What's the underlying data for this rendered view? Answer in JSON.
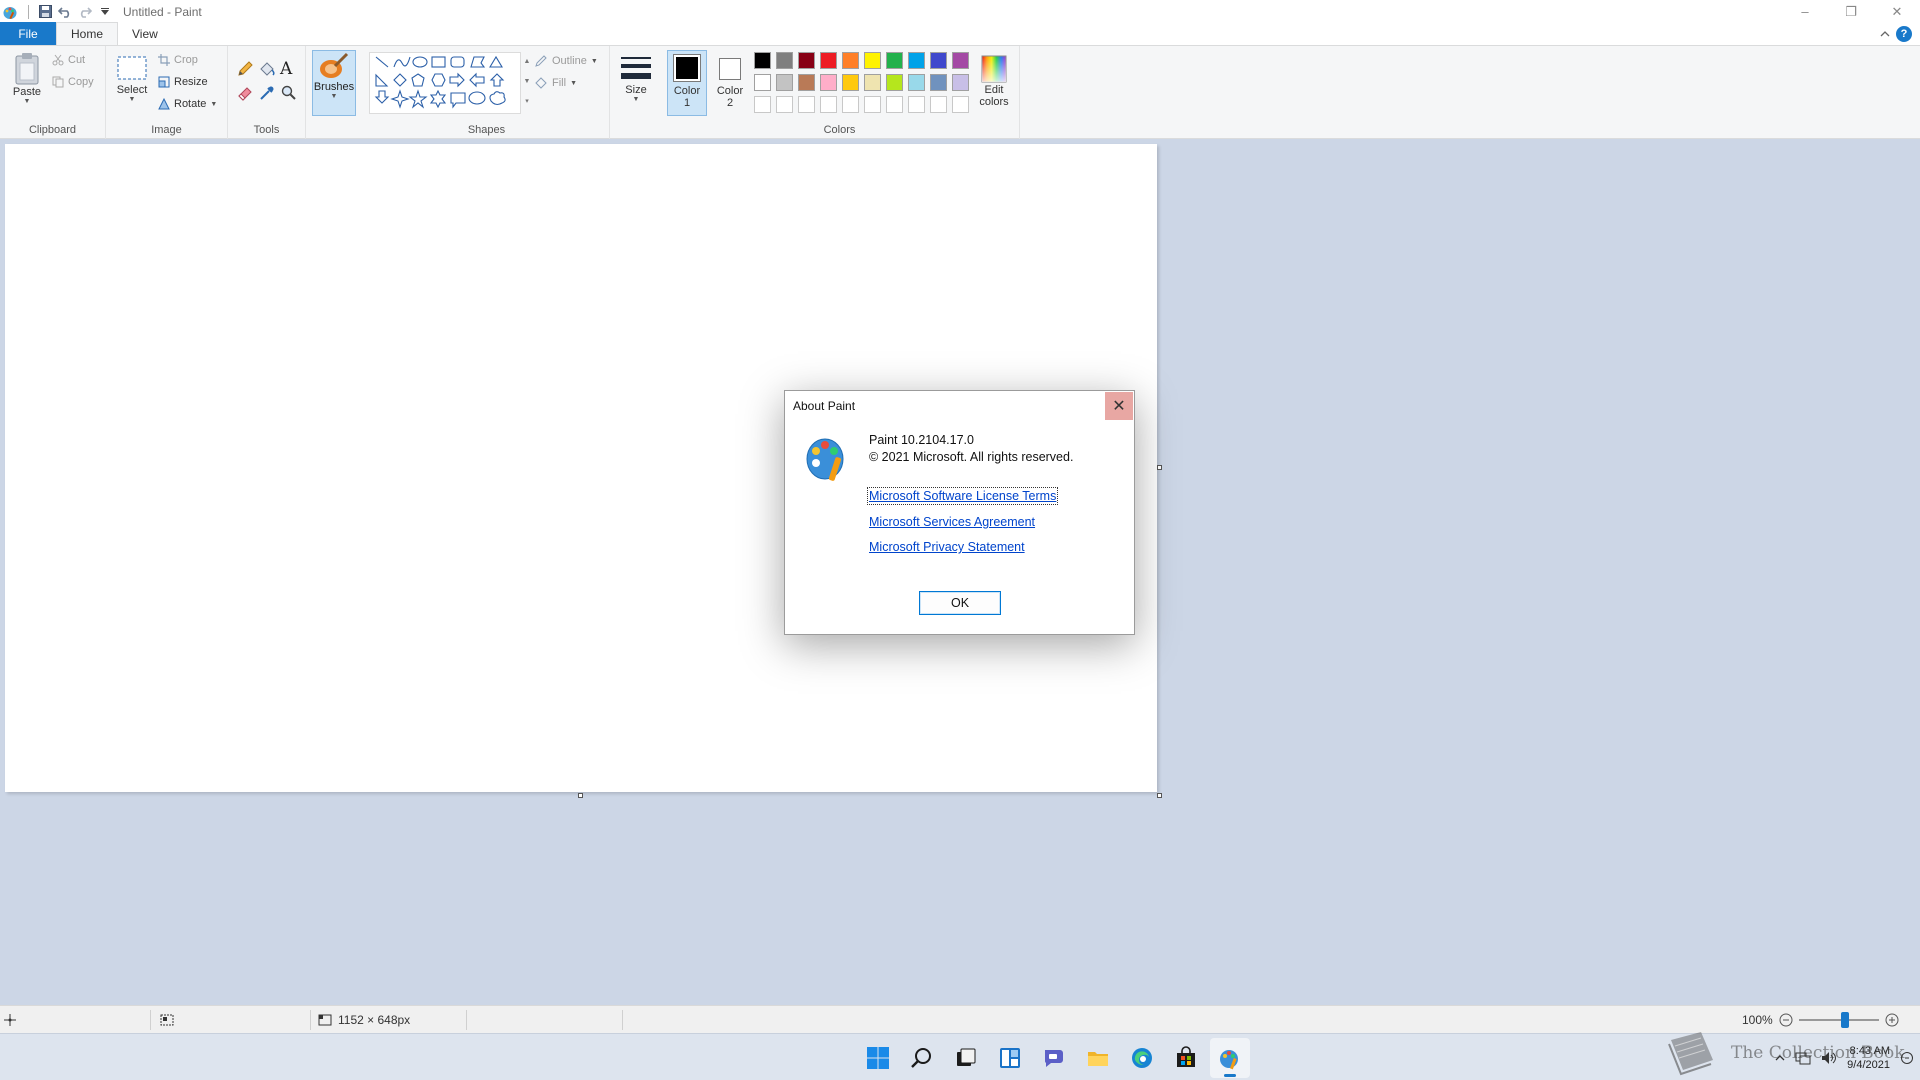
{
  "titlebar": {
    "title": "Untitled - Paint",
    "minimize": "–",
    "restore": "❐",
    "close": "✕"
  },
  "tabs": {
    "file": "File",
    "home": "Home",
    "view": "View"
  },
  "ribbon": {
    "clipboard": {
      "label": "Clipboard",
      "paste": "Paste",
      "cut": "Cut",
      "copy": "Copy"
    },
    "image": {
      "label": "Image",
      "select": "Select",
      "crop": "Crop",
      "resize": "Resize",
      "rotate": "Rotate"
    },
    "tools": {
      "label": "Tools"
    },
    "brushes": {
      "label": "Brushes"
    },
    "shapes": {
      "label": "Shapes",
      "outline": "Outline",
      "fill": "Fill"
    },
    "size": {
      "label": "Size"
    },
    "color1": {
      "line1": "Color",
      "line2": "1",
      "value": "#000000"
    },
    "color2": {
      "line1": "Color",
      "line2": "2",
      "value": "#ffffff"
    },
    "colors": {
      "label": "Colors",
      "edit_line1": "Edit",
      "edit_line2": "colors",
      "row1": [
        "#000000",
        "#7f7f7f",
        "#880015",
        "#ed1c24",
        "#ff7f27",
        "#fff200",
        "#22b14c",
        "#00a2e8",
        "#3f48cc",
        "#a349a4"
      ],
      "row2": [
        "#ffffff",
        "#c3c3c3",
        "#b97a57",
        "#ffaec9",
        "#ffc90e",
        "#efe4b0",
        "#b5e61d",
        "#99d9ea",
        "#7092be",
        "#c8bfe7"
      ],
      "row3": [
        "#ffffff",
        "#ffffff",
        "#ffffff",
        "#ffffff",
        "#ffffff",
        "#ffffff",
        "#ffffff",
        "#ffffff",
        "#ffffff",
        "#ffffff"
      ]
    }
  },
  "statusbar": {
    "dimensions": "1152 × 648px",
    "zoom": "100%"
  },
  "dialog": {
    "title": "About Paint",
    "version": "Paint 10.2104.17.0",
    "copyright": "© 2021 Microsoft. All rights reserved.",
    "link_license": "Microsoft Software License Terms",
    "link_services": "Microsoft Services Agreement",
    "link_privacy": "Microsoft Privacy Statement",
    "ok": "OK"
  },
  "taskbar": {
    "time": "8:43 AM",
    "date": "9/4/2021"
  },
  "watermark": {
    "text": "The Collection Book"
  }
}
